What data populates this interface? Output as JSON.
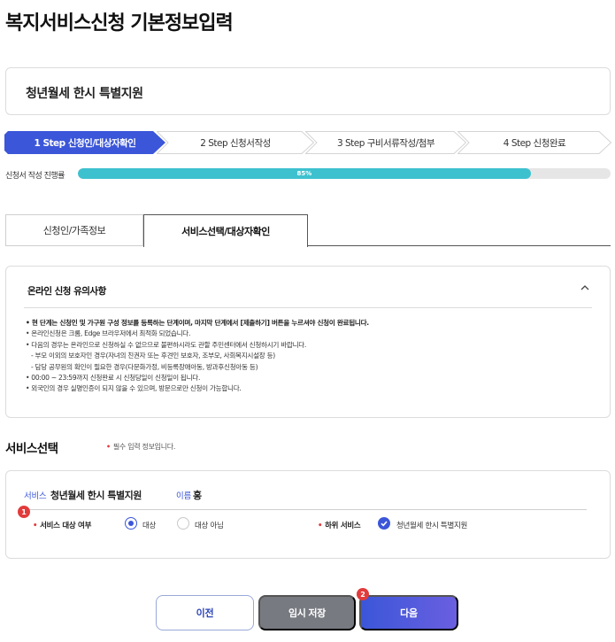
{
  "page_title": "복지서비스신청 기본정보입력",
  "program_name": "청년월세 한시 특별지원",
  "steps": [
    {
      "label": "1 Step 신청인/대상자확인",
      "active": true
    },
    {
      "label": "2 Step 신청서작성",
      "active": false
    },
    {
      "label": "3 Step 구비서류작성/첨부",
      "active": false
    },
    {
      "label": "4 Step 신청완료",
      "active": false
    }
  ],
  "progress": {
    "label": "신청서 작성 진행률",
    "value_text": "85%",
    "value": 85
  },
  "tabs": [
    {
      "label": "신청인/가족정보",
      "active": false
    },
    {
      "label": "서비스선택/대상자확인",
      "active": true
    }
  ],
  "notice": {
    "title": "온라인 신청 유의사항",
    "items": [
      "• 현 단계는 신청인 및 가구원 구성 정보를 등록하는 단계이며, 마지막 단계에서 [제출하기] 버튼을 누르셔야 신청이 완료됩니다.",
      "• 온라인신청은 크롬, Edge 브라우저에서 최적화 되었습니다.",
      "• 다음의 경우는 온라인으로 신청하실 수 없으므로 불편하시라도 관할 주민센터에서 신청하시기 바랍니다.",
      "  - 부모 이외의 보호자인 경우(자녀의 친권자 또는 후견인 보호자, 조부모, 사회복지시설장 등)",
      "  - 담당 공무원의 확인이 필요한 경우(다문화가정, 비등록장애아동, 방과후신청아동 등)",
      "• 00:00 ~ 23:59까지 신청완료 시 신청당일이 신청일이 됩니다.",
      "• 외국인의 경우 실명인증이 되지 않을 수 있으며, 방문으로만 신청이 가능합니다."
    ]
  },
  "service_section": {
    "title": "서비스선택",
    "required_note": "필수 입력 정보입니다.",
    "service_key": "서비스",
    "service_value": "청년월세 한시 특별지원",
    "name_key": "이름",
    "name_value": "홍",
    "target_label": "서비스 대상 여부",
    "options": [
      {
        "label": "대상",
        "checked": true
      },
      {
        "label": "대상 아님",
        "checked": false
      }
    ],
    "sub_label": "하위 서비스",
    "sub_service": "청년월세 한시 특별지원",
    "badge_1": "1",
    "badge_2": "2"
  },
  "buttons": {
    "prev": "이전",
    "save": "임시 저장",
    "next": "다음"
  },
  "colors": {
    "primary": "#3b56d9",
    "progress": "#3ec1cf",
    "required": "#e23b3b"
  }
}
